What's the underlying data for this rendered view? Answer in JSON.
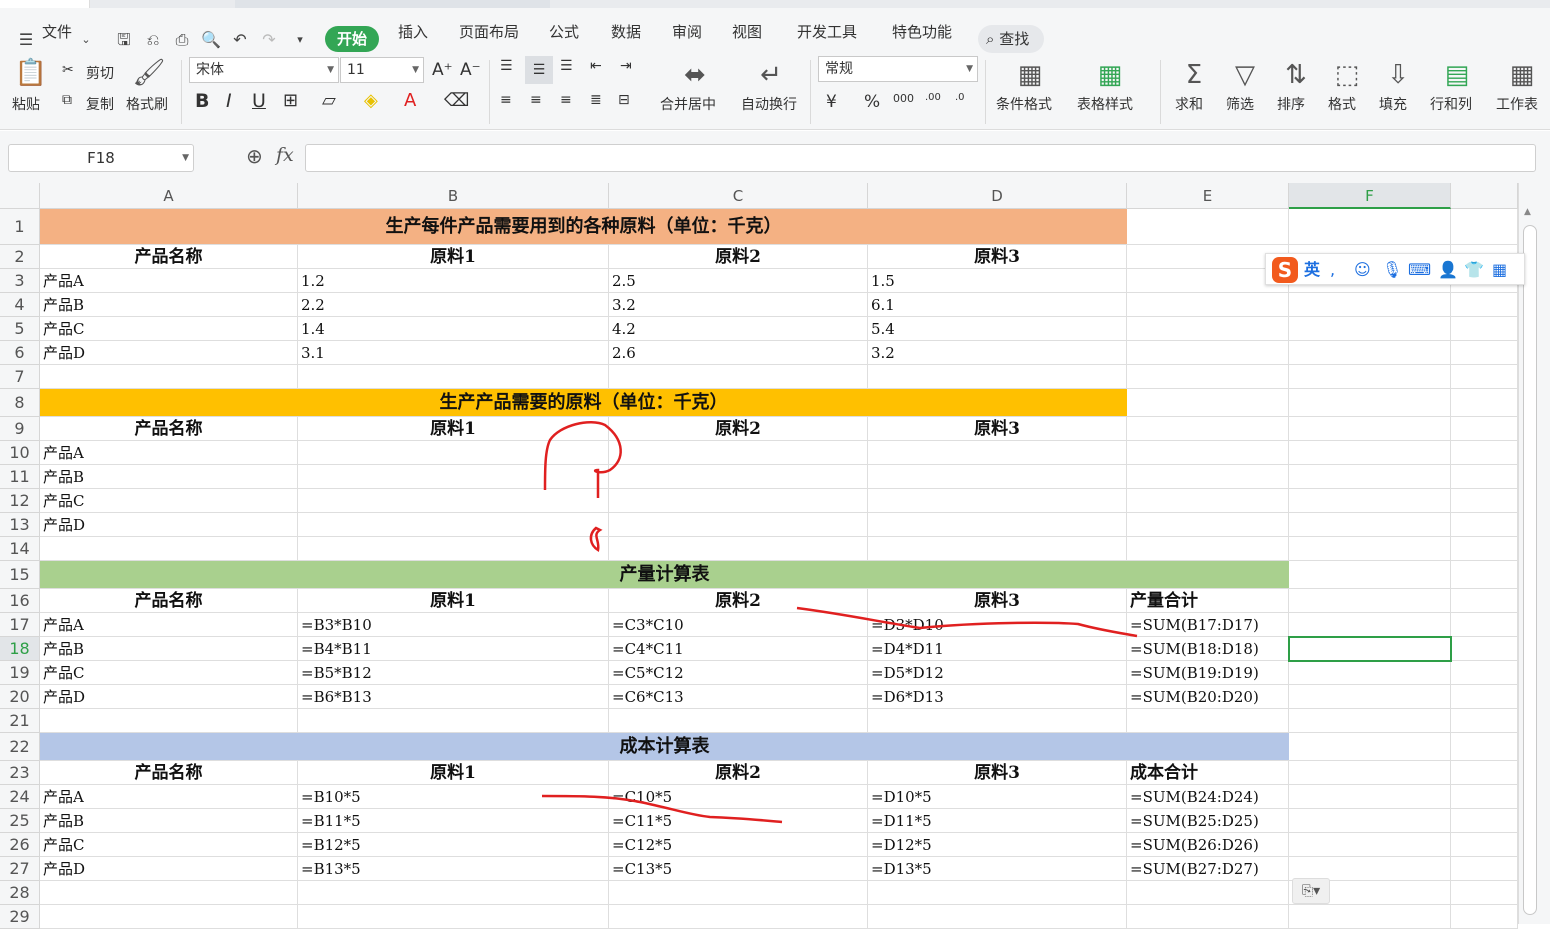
{
  "menu": {
    "file_label": "文件",
    "start_tab": "开始",
    "tabs": [
      "插入",
      "页面布局",
      "公式",
      "数据",
      "审阅",
      "视图",
      "开发工具",
      "特色功能"
    ],
    "search_label": "查找"
  },
  "ribbon": {
    "paste": "粘贴",
    "cut": "剪切",
    "copy": "复制",
    "format_painter": "格式刷",
    "font_name": "宋体",
    "font_size": "11",
    "merge_center": "合并居中",
    "wrap_text": "自动换行",
    "number_format": "常规",
    "conditional_format": "条件格式",
    "table_style": "表格样式",
    "sum": "求和",
    "filter": "筛选",
    "sort": "排序",
    "format": "格式",
    "fill": "填充",
    "rows_cols": "行和列",
    "worksheet": "工作表"
  },
  "formula_bar": {
    "name_box": "F18",
    "fx": "fx",
    "content": ""
  },
  "columns": [
    "A",
    "B",
    "C",
    "D",
    "E",
    "F"
  ],
  "rows": [
    "1",
    "2",
    "3",
    "4",
    "5",
    "6",
    "7",
    "8",
    "9",
    "10",
    "11",
    "12",
    "13",
    "14",
    "15",
    "16",
    "17",
    "18",
    "19",
    "20",
    "21",
    "22",
    "23",
    "24",
    "25",
    "26",
    "27",
    "28",
    "29"
  ],
  "sheet": {
    "t1_title": "生产每件产品需要用到的各种原料（单位：千克）",
    "t2_title": "生产产品需要的原料（单位：千克）",
    "t3_title": "产量计算表",
    "t4_title": "成本计算表",
    "h_name": "产品名称",
    "h_m1": "原料1",
    "h_m2": "原料2",
    "h_m3": "原料3",
    "h_qty_total": "产量合计",
    "h_cost_total": "成本合计",
    "r3": [
      "产品A",
      "1.2",
      "2.5",
      "1.5"
    ],
    "r4": [
      "产品B",
      "2.2",
      "3.2",
      "6.1"
    ],
    "r5": [
      "产品C",
      "1.4",
      "4.2",
      "5.4"
    ],
    "r6": [
      "产品D",
      "3.1",
      "2.6",
      "3.2"
    ],
    "r10": [
      "产品A"
    ],
    "r11": [
      "产品B"
    ],
    "r12": [
      "产品C"
    ],
    "r13": [
      "产品D"
    ],
    "r17": [
      "产品A",
      "=B3*B10",
      "=C3*C10",
      "=D3*D10",
      "=SUM(B17:D17)"
    ],
    "r18": [
      "产品B",
      "=B4*B11",
      "=C4*C11",
      "=D4*D11",
      "=SUM(B18:D18)"
    ],
    "r19": [
      "产品C",
      "=B5*B12",
      "=C5*C12",
      "=D5*D12",
      "=SUM(B19:D19)"
    ],
    "r20": [
      "产品D",
      "=B6*B13",
      "=C6*C13",
      "=D6*D13",
      "=SUM(B20:D20)"
    ],
    "r24": [
      "产品A",
      "=B10*5",
      "=C10*5",
      "=D10*5",
      "=SUM(B24:D24)"
    ],
    "r25": [
      "产品B",
      "=B11*5",
      "=C11*5",
      "=D11*5",
      "=SUM(B25:D25)"
    ],
    "r26": [
      "产品C",
      "=B12*5",
      "=C12*5",
      "=D12*5",
      "=SUM(B26:D26)"
    ],
    "r27": [
      "产品D",
      "=B13*5",
      "=C13*5",
      "=D13*5",
      "=SUM(B27:D27)"
    ]
  },
  "colors": {
    "t1_fill": "#f4b183",
    "t2_fill": "#ffc000",
    "t3_fill": "#a9d08e",
    "t4_fill": "#b4c6e7",
    "accent_green": "#33a655",
    "selection": "#2e9f47",
    "annotation": "#e02020"
  },
  "ime": {
    "mode": "英",
    "icons": [
      "punctuation-icon",
      "emoji-icon",
      "microphone-icon",
      "keyboard-icon",
      "user-icon",
      "skin-icon",
      "grid-icon"
    ]
  }
}
